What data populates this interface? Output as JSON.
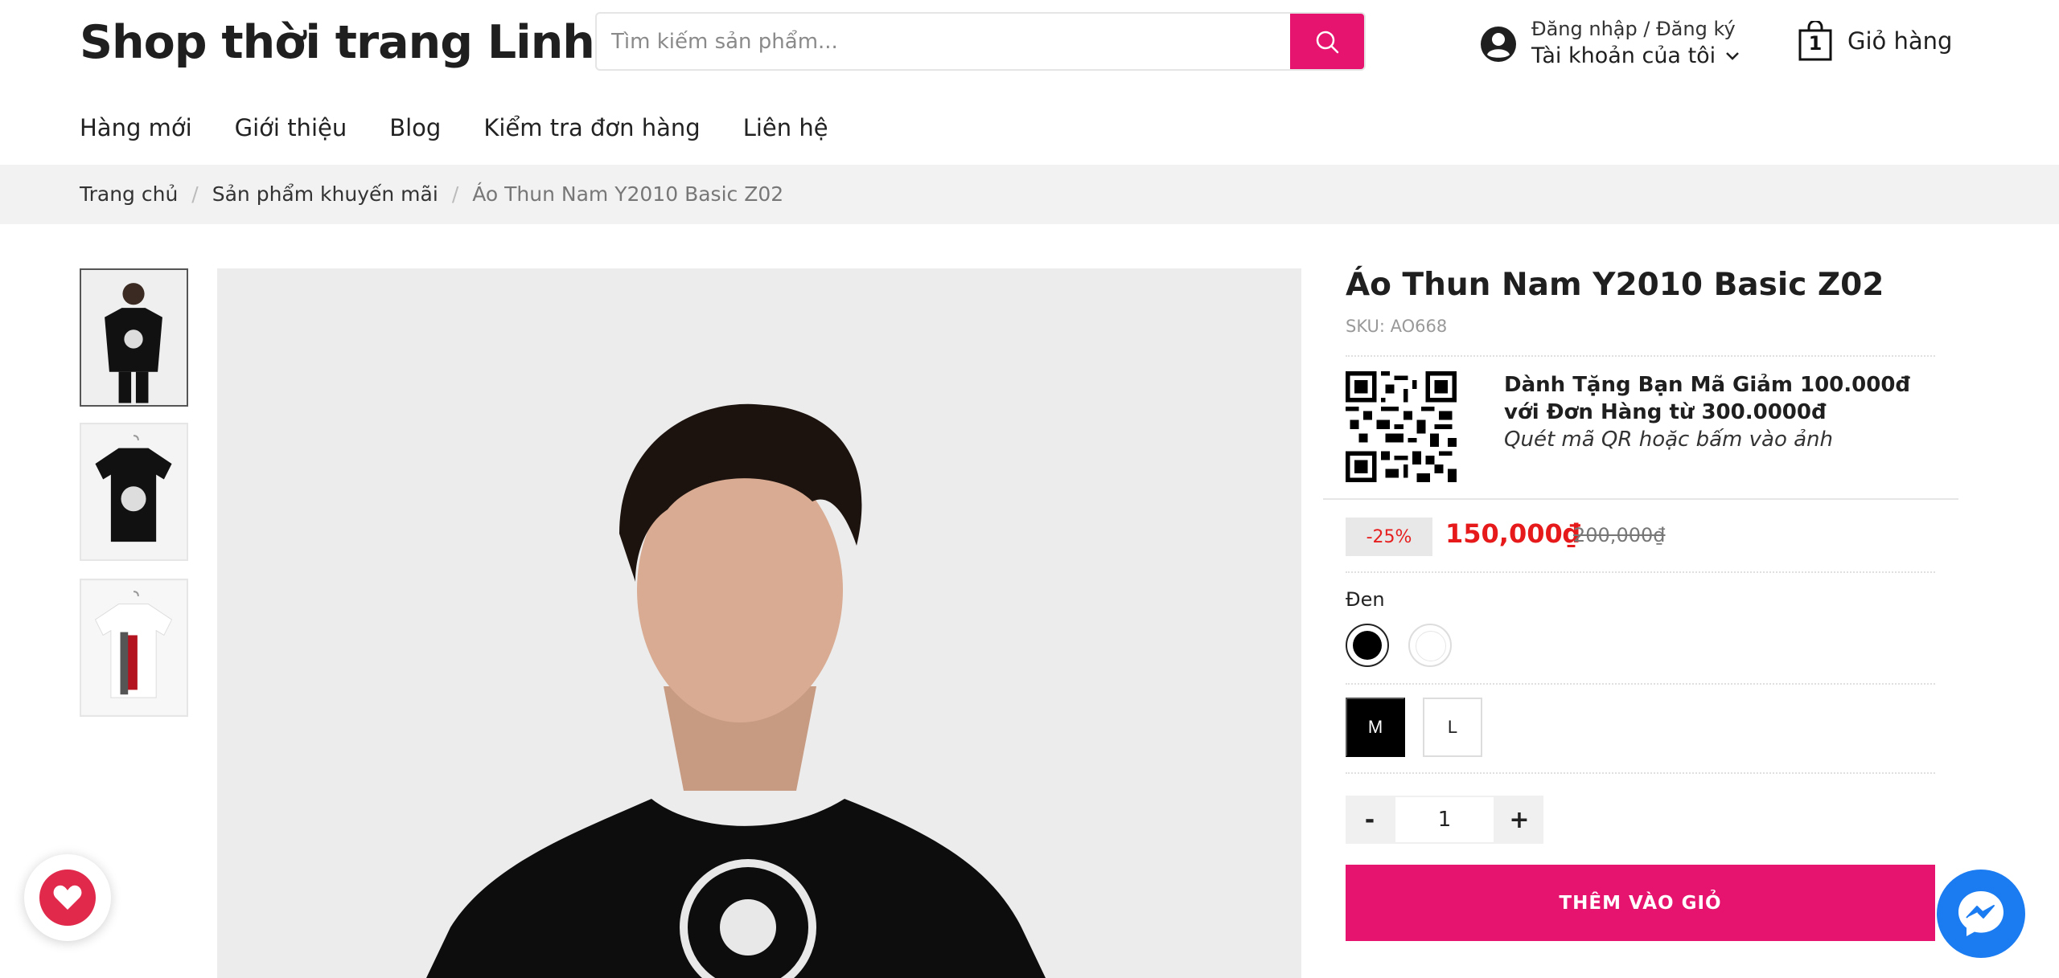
{
  "header": {
    "shop_name": "Shop thời trang Linh",
    "search": {
      "placeholder": "Tìm kiếm sản phẩm...",
      "value": "",
      "icon": "search-icon"
    },
    "account": {
      "login_text": "Đăng nhập / Đăng ký",
      "my_account": "Tài khoản của tôi",
      "icon": "user-icon"
    },
    "cart": {
      "count": "1",
      "label": "Giỏ hàng",
      "icon": "bag-icon"
    }
  },
  "nav": {
    "items": [
      {
        "label": "Hàng mới"
      },
      {
        "label": "Giới thiệu"
      },
      {
        "label": "Blog"
      },
      {
        "label": "Kiểm tra đơn hàng"
      },
      {
        "label": "Liên hệ"
      }
    ]
  },
  "breadcrumb": {
    "items": [
      {
        "label": "Trang chủ"
      },
      {
        "label": "Sản phẩm khuyến mãi"
      },
      {
        "label": "Áo Thun Nam Y2010 Basic Z02"
      }
    ],
    "separator": "/"
  },
  "gallery": {
    "active_index": 0,
    "thumbnails": [
      {
        "alt": "model-front"
      },
      {
        "alt": "black-tee-hanger"
      },
      {
        "alt": "white-tee-hanger"
      }
    ]
  },
  "product": {
    "title": "Áo Thun Nam Y2010 Basic Z02",
    "sku": "SKU: AO668",
    "promo": {
      "title": "Dành Tặng Bạn Mã Giảm 100.000đ với Đơn Hàng từ 300.0000đ",
      "subtitle": "Quét mã QR hoặc bấm vào ảnh"
    },
    "discount": "-25%",
    "price": "150,000₫",
    "old_price": "200,000₫",
    "color": {
      "selected_label": "Đen",
      "options": [
        {
          "value": "#000000"
        },
        {
          "value": "#ffffff"
        }
      ]
    },
    "sizes": [
      {
        "label": "M",
        "selected": true
      },
      {
        "label": "L",
        "selected": false
      }
    ],
    "quantity": {
      "minus": "-",
      "value": "1",
      "plus": "+"
    },
    "add_to_cart": "THÊM VÀO GIỎ"
  },
  "colors": {
    "accent": "#e6146e",
    "price": "#e61a1a",
    "messenger": "#1b7cf2",
    "favorite": "#e0294b"
  },
  "floating": {
    "favorite_icon": "heart-icon",
    "messenger_icon": "messenger-icon"
  }
}
